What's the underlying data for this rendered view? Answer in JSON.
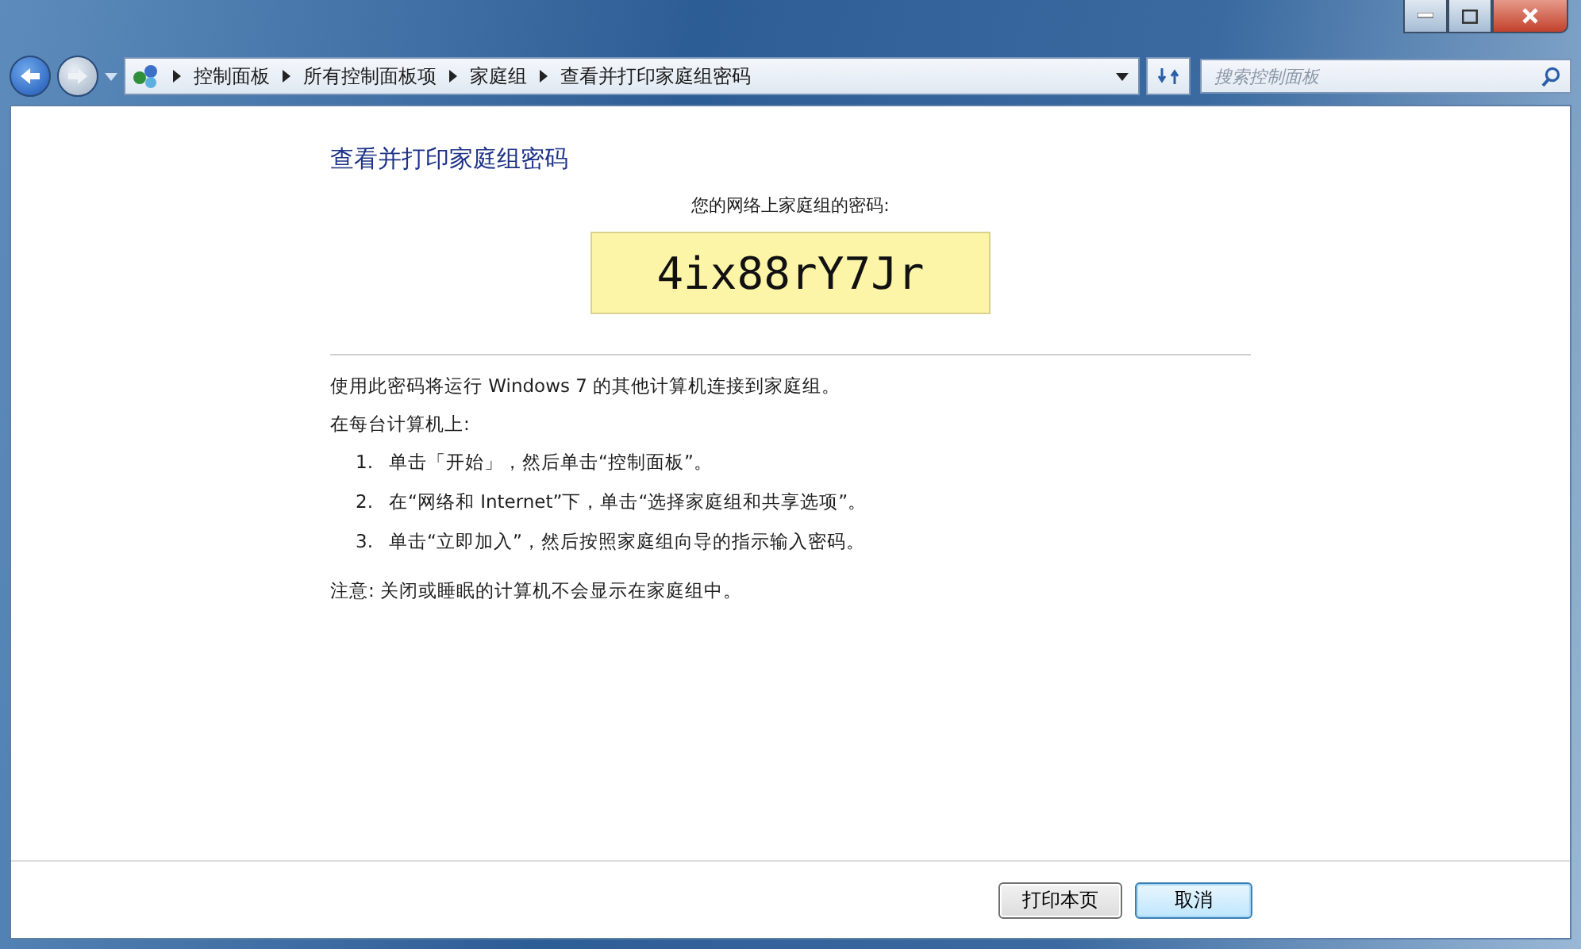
{
  "breadcrumb": [
    "控制面板",
    "所有控制面板项",
    "家庭组",
    "查看并打印家庭组密码"
  ],
  "search": {
    "placeholder": "搜索控制面板"
  },
  "heading": "查看并打印家庭组密码",
  "password_label": "您的网络上家庭组的密码:",
  "password": "4ix88rY7Jr",
  "intro": "使用此密码将运行 Windows 7 的其他计算机连接到家庭组。",
  "subheading": "在每台计算机上:",
  "steps": [
    {
      "number": "1.",
      "text": "单击「开始」，然后单击“控制面板”。"
    },
    {
      "number": "2.",
      "text": "在“网络和 Internet”下，单击“选择家庭组和共享选项”。"
    },
    {
      "number": "3.",
      "text": "单击“立即加入”，然后按照家庭组向导的指示输入密码。"
    }
  ],
  "note": "注意: 关闭或睡眠的计算机不会显示在家庭组中。",
  "buttons": [
    {
      "label": "打印本页",
      "default": false
    },
    {
      "label": "取消",
      "default": true
    }
  ]
}
